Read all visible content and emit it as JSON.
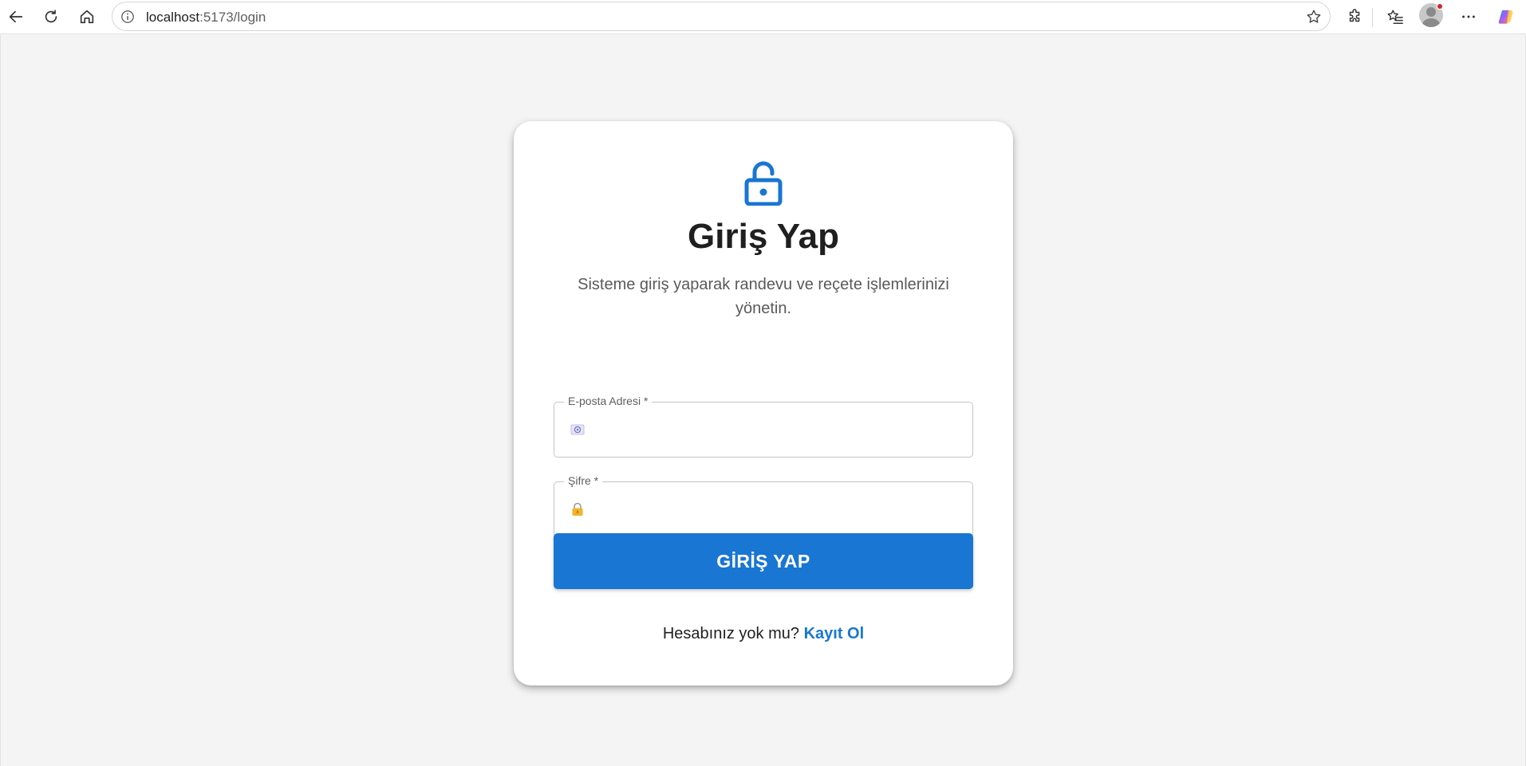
{
  "browser": {
    "url_host": "localhost",
    "url_path": ":5173/login",
    "icons": [
      "back-arrow-icon",
      "reload-icon",
      "home-icon",
      "info-icon",
      "star-icon",
      "extensions-icon",
      "favorites-icon",
      "profile-icon",
      "more-icon",
      "copilot-icon"
    ]
  },
  "login": {
    "title": "Giriş Yap",
    "subtitle": "Sisteme giriş yaparak randevu ve reçete işlemlerinizi yönetin.",
    "email": {
      "label": "E-posta Adresi *",
      "value": "",
      "placeholder": ""
    },
    "password": {
      "label": "Şifre *",
      "value": "",
      "placeholder": ""
    },
    "submit_label": "GİRİŞ YAP",
    "footer_text": "Hesabınız yok mu?",
    "register_link": "Kayıt Ol"
  },
  "colors": {
    "primary": "#1976d2",
    "background": "#f4f4f4",
    "card": "#ffffff",
    "text": "#1f1f1f",
    "muted": "#5a5a5a"
  }
}
